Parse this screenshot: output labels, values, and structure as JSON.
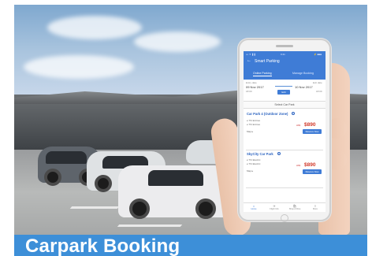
{
  "banner": {
    "title": "Carpark Booking",
    "color": "#3d8fd8"
  },
  "app": {
    "status_bar": {
      "carrier": "••• ✈ ❚❚",
      "time": "9:41",
      "battery": "⚡ ■■■"
    },
    "header": {
      "back_icon": "arrow-left-icon",
      "title": "Smart Parking"
    },
    "tabs": [
      {
        "label": "Online Parking",
        "active": true
      },
      {
        "label": "Manage Booking",
        "active": false
      }
    ],
    "search": {
      "entry_label": "Entry date",
      "entry_date": "09 Nov 2017",
      "entry_time": "18:00",
      "exit_label": "Exit date",
      "exit_date": "10 Nov 2017",
      "exit_time": "18:00",
      "button_label": "Edit"
    },
    "select_label": "Select Car Park",
    "carparks": [
      {
        "name": "Car Park 4 (Outdoor Zone)",
        "features": [
          "≥ 7% Entries",
          "≥ 7% Entries"
        ],
        "link": "Map ▸",
        "currency": "HK$",
        "price": "$890",
        "button_label": "Reserve Now"
      },
      {
        "name": "SkyCity Car Park",
        "features": [
          "≥ 7% Electric",
          "≥ 7% Electric"
        ],
        "link": "Map ▸",
        "currency": "HK$",
        "price": "$890",
        "button_label": "Reserve Now"
      }
    ],
    "bottom_nav": [
      {
        "icon": "home-icon",
        "glyph": "⌂",
        "label": "Home",
        "active": true
      },
      {
        "icon": "flight-icon",
        "glyph": "✈",
        "label": "Flight Info",
        "active": false
      },
      {
        "icon": "shop-icon",
        "glyph": "🛍",
        "label": "Shop & Dine",
        "active": false
      },
      {
        "icon": "menu-icon",
        "glyph": "≡",
        "label": "More",
        "active": false
      }
    ]
  }
}
